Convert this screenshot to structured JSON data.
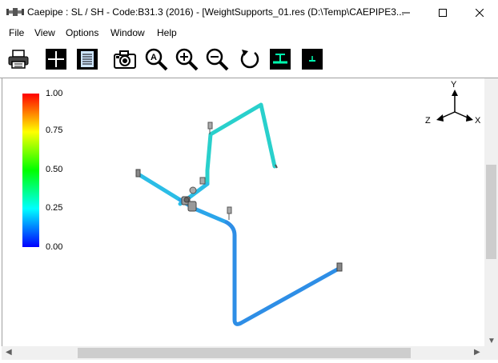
{
  "window": {
    "title": "Caepipe : SL / SH - Code:B31.3 (2016) -  [WeightSupports_01.res (D:\\Temp\\CAEPIPE3...",
    "minimize_icon": "minimize-icon",
    "maximize_icon": "maximize-icon",
    "close_icon": "close-icon"
  },
  "menu": {
    "items": [
      "File",
      "View",
      "Options",
      "Window",
      "Help"
    ]
  },
  "toolbar": {
    "icons": [
      "printer-icon",
      "crosshair-icon",
      "document-icon",
      "camera-icon",
      "zoom-all-icon",
      "zoom-in-icon",
      "zoom-out-icon",
      "rotate-icon",
      "support-icon",
      "small-support-icon"
    ]
  },
  "legend": {
    "labels": [
      "1.00",
      "0.75",
      "0.50",
      "0.25",
      "0.00"
    ],
    "colors": [
      "#ff0000",
      "#ffff00",
      "#00ff00",
      "#00ffff",
      "#0000ff"
    ]
  },
  "axes": {
    "y": "Y",
    "z": "Z",
    "x": "X"
  },
  "colors": {
    "pipe_high": "#29d3c8",
    "pipe_mid": "#2bb8e8",
    "pipe_low": "#2e8ee6",
    "pipe_lowest": "#2a7fe2"
  }
}
